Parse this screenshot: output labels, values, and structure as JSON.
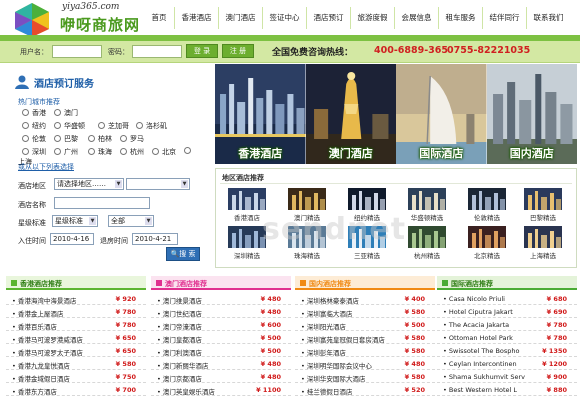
{
  "header": {
    "site_url": "yiya365.com",
    "site_name": "咿呀商旅网",
    "nav": [
      "首页",
      "香港酒店",
      "澳门酒店",
      "签证中心",
      "酒店预订",
      "旅游度假",
      "会展信息",
      "租车服务",
      "结伴同行",
      "联系我们"
    ]
  },
  "login": {
    "username_label": "用户名：",
    "password_label": "密码：",
    "login_button": "登 录",
    "register_button": "注 册",
    "hotline_label": "全国免费咨询热线：",
    "hotline_1": "400-6889-365",
    "hotline_2": "0755-82221035"
  },
  "booking": {
    "title": "酒店预订服务",
    "hot_title": "热门城市推荐",
    "cities": [
      "香港",
      "澳门",
      "纽约",
      "华盛顿",
      "芝加哥",
      "洛杉矶",
      "伦敦",
      "巴黎",
      "柏林",
      "罗马",
      "深圳",
      "广州",
      "珠海",
      "杭州",
      "北京",
      "上海"
    ],
    "more_link": "或从以下列表选择",
    "area_label": "酒店地区",
    "area_value": "请选择地区……",
    "name_label": "酒店名称",
    "star_label": "星级标准",
    "star_value": "星级标准",
    "star_all": "全部",
    "checkin_label": "入住时间",
    "checkin_value": "2010-4-16",
    "checkout_label": "退房时间",
    "checkout_value": "2010-4-21",
    "search_button": "搜 索"
  },
  "banner": [
    "香港酒店",
    "澳门酒店",
    "国际酒店",
    "国内酒店"
  ],
  "recommend": {
    "title": "地区酒店推荐",
    "items": [
      "香港酒店",
      "澳门精选",
      "纽约精选",
      "华盛顿精选",
      "伦敦精选",
      "巴黎精选",
      "深圳精选",
      "珠海精选",
      "三亚精选",
      "杭州精选",
      "北京精选",
      "上海精选"
    ]
  },
  "watermark": "sendnet",
  "lists": [
    {
      "title": "香港酒店推荐",
      "color": "#5cb531",
      "bg": "#e9f6dc",
      "rows": [
        {
          "name": "香港海湾中海景酒店",
          "price": "¥ 920"
        },
        {
          "name": "香港金上屋酒店",
          "price": "¥ 780"
        },
        {
          "name": "香港百乐酒店",
          "price": "¥ 780"
        },
        {
          "name": "香港马可波罗港威酒店",
          "price": "¥ 650"
        },
        {
          "name": "香港马可波罗太子酒店",
          "price": "¥ 650"
        },
        {
          "name": "香港九龙皇悦酒店",
          "price": "¥ 580"
        },
        {
          "name": "香港金域假日酒店",
          "price": "¥ 750"
        },
        {
          "name": "香港东方酒店",
          "price": "¥ 700"
        }
      ]
    },
    {
      "title": "澳门酒店推荐",
      "color": "#e0308f",
      "bg": "#fbe3f0",
      "rows": [
        {
          "name": "澳门维景酒店",
          "price": "¥ 480"
        },
        {
          "name": "澳门世纪酒店",
          "price": "¥ 480"
        },
        {
          "name": "澳门帝濠酒店",
          "price": "¥ 600"
        },
        {
          "name": "澳门皇都酒店",
          "price": "¥ 500"
        },
        {
          "name": "澳门利澳酒店",
          "price": "¥ 500"
        },
        {
          "name": "澳门新丽华酒店",
          "price": "¥ 480"
        },
        {
          "name": "澳门京都酒店",
          "price": "¥ 480"
        },
        {
          "name": "澳门英皇娱乐酒店",
          "price": "¥ 1100"
        }
      ]
    },
    {
      "title": "国内酒店推荐",
      "color": "#f08a14",
      "bg": "#fdecd6",
      "rows": [
        {
          "name": "深圳格林豪泰酒店",
          "price": "¥ 400"
        },
        {
          "name": "深圳富临大酒店",
          "price": "¥ 580"
        },
        {
          "name": "深圳阳光酒店",
          "price": "¥ 500"
        },
        {
          "name": "深圳富苑皇冠假日套房酒店",
          "price": "¥ 580"
        },
        {
          "name": "深圳彭年酒店",
          "price": "¥ 580"
        },
        {
          "name": "深圳明华国际会议中心",
          "price": "¥ 480"
        },
        {
          "name": "深圳华安国际大酒店",
          "price": "¥ 580"
        },
        {
          "name": "桂兰德假日酒店",
          "price": "¥ 520"
        }
      ]
    },
    {
      "title": "国际酒店推荐",
      "color": "#4aab34",
      "bg": "#e4f3d9",
      "rows": [
        {
          "name": "Casa Nicolo Priuli",
          "price": "¥ 680"
        },
        {
          "name": "Hotel Ciputra Jakart",
          "price": "¥ 690"
        },
        {
          "name": "The Acacia Jakarta",
          "price": "¥ 780"
        },
        {
          "name": "Ottoman Hotel Park",
          "price": "¥ 780"
        },
        {
          "name": "Swissotel The Bospho",
          "price": "¥ 1350"
        },
        {
          "name": "Ceylan Intercontinen",
          "price": "¥ 1200"
        },
        {
          "name": "Shama Sukhumvit Serv",
          "price": "¥ 900"
        },
        {
          "name": "Best Western Hotel L",
          "price": "¥ 880"
        }
      ]
    }
  ]
}
